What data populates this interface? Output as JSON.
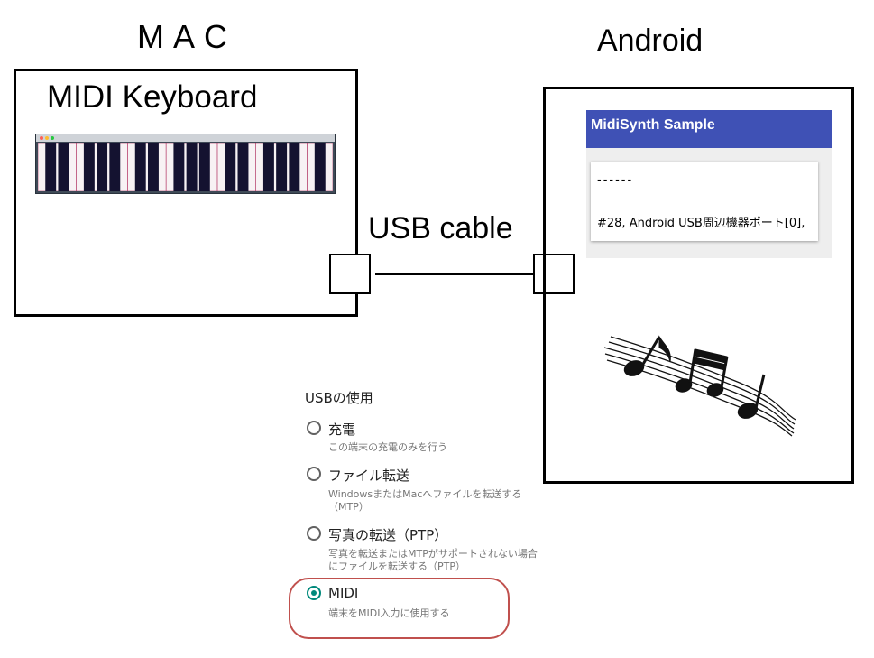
{
  "labels": {
    "mac": "MAC",
    "android": "Android",
    "mac_box_title": "MIDI Keyboard",
    "usb_cable": "USB cable"
  },
  "android_app": {
    "title": "MidiSynth Sample",
    "dashes": "------",
    "port_text": "#28, Android USB周辺機器ポート[0],"
  },
  "usb_settings": {
    "title": "USBの使用",
    "options": [
      {
        "label": "充電",
        "description": "この端末の充電のみを行う",
        "selected": false
      },
      {
        "label": "ファイル転送",
        "description": "WindowsまたはMacへファイルを転送する（MTP）",
        "selected": false
      },
      {
        "label": "写真の転送（PTP）",
        "description": "写真を転送またはMTPがサポートされない場合にファイルを転送する（PTP）",
        "selected": false
      },
      {
        "label": "MIDI",
        "description": "端末をMIDI入力に使用する",
        "selected": true
      }
    ]
  },
  "colors": {
    "app_bar": "#3f51b5",
    "radio_selected": "#00897b",
    "highlight_border": "#c0504d",
    "keyboard_frame": "#3f4a57"
  },
  "icons": [
    "music-notes-icon",
    "radio-unchecked-icon",
    "radio-checked-icon"
  ]
}
